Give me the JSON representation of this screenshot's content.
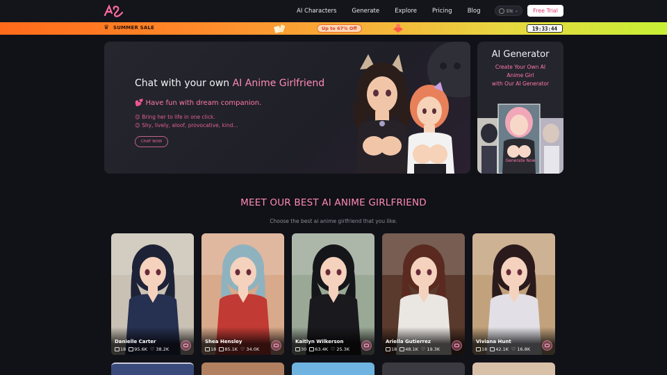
{
  "nav": {
    "links": [
      "AI Characters",
      "Generate",
      "Explore",
      "Pricing",
      "Blog"
    ],
    "lang": "EN",
    "trial": "Free Trial"
  },
  "banner": {
    "sale": "SUMMER SALE",
    "offer": "Up to 67% Off",
    "timer": "19:33:44"
  },
  "hero": {
    "title_plain": "Chat with your own ",
    "title_pink": "AI Anime Girlfriend",
    "sub": "💕 Have fun with dream companion.",
    "line1": "😊 Bring her to life in one click.",
    "line2": "😊 Shy, lively, aloof, provocative, kind...",
    "cta": "CHAT NOW"
  },
  "generator": {
    "title": "AI Generator",
    "lines": [
      "Create Your Own AI",
      "Anime Girl",
      "with Our AI Generator"
    ],
    "button": "Generate Now"
  },
  "section": {
    "title_plain": "MEET OUR ",
    "title_pink": "BEST AI ANIME GIRLFRIEND",
    "subtitle": "Choose the best ai anime girlfriend that you like."
  },
  "cards": [
    {
      "name": "Danielle Carter",
      "age": "18",
      "chats": "95.6K",
      "likes": "38.2K",
      "bg": "#c9c1b4",
      "hair": "#1d2236",
      "outfit": "#263050"
    },
    {
      "name": "Shea Hensley",
      "age": "18",
      "chats": "85.1K",
      "likes": "34.0K",
      "bg": "#d8a98a",
      "hair": "#8fb2bf",
      "outfit": "#c13a34"
    },
    {
      "name": "Kaitlyn Wilkerson",
      "age": "30",
      "chats": "63.4K",
      "likes": "25.3K",
      "bg": "#9aa896",
      "hair": "#151619",
      "outfit": "#1a1a1e"
    },
    {
      "name": "Ariella Gutierrez",
      "age": "18",
      "chats": "48.1K",
      "likes": "19.3K",
      "bg": "#5a3a2c",
      "hair": "#5a2a20",
      "outfit": "#eae6e2"
    },
    {
      "name": "Viviana Hunt",
      "age": "18",
      "chats": "42.1K",
      "likes": "16.8K",
      "bg": "#c2a27c",
      "hair": "#2a1a1c",
      "outfit": "#e2e0e6"
    }
  ],
  "colors": {
    "accent": "#ff8bb5",
    "background": "#111118"
  }
}
